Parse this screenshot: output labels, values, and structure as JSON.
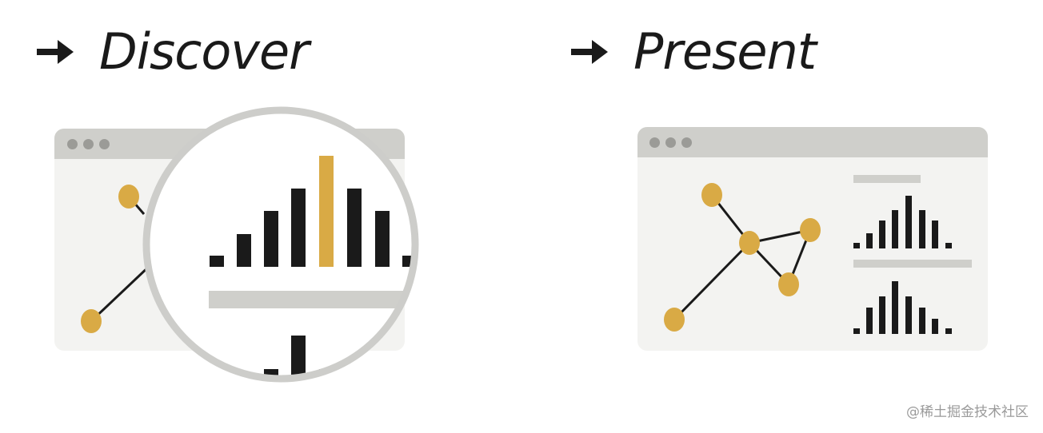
{
  "headings": {
    "discover": "Discover",
    "present": "Present"
  },
  "watermark": "@稀土掘金技术社区",
  "colors": {
    "accent": "#d9aa45",
    "ink": "#1a1a1a",
    "window_bg": "#f3f3f1",
    "title_bar": "#cfcfcb",
    "window_dots": "#9b9b97",
    "magnifier_rim": "#cdcdca"
  },
  "icons": [
    "arrow-right-icon",
    "window-dots-icon",
    "magnifier-icon",
    "network-graph-icon",
    "histogram-icon"
  ]
}
